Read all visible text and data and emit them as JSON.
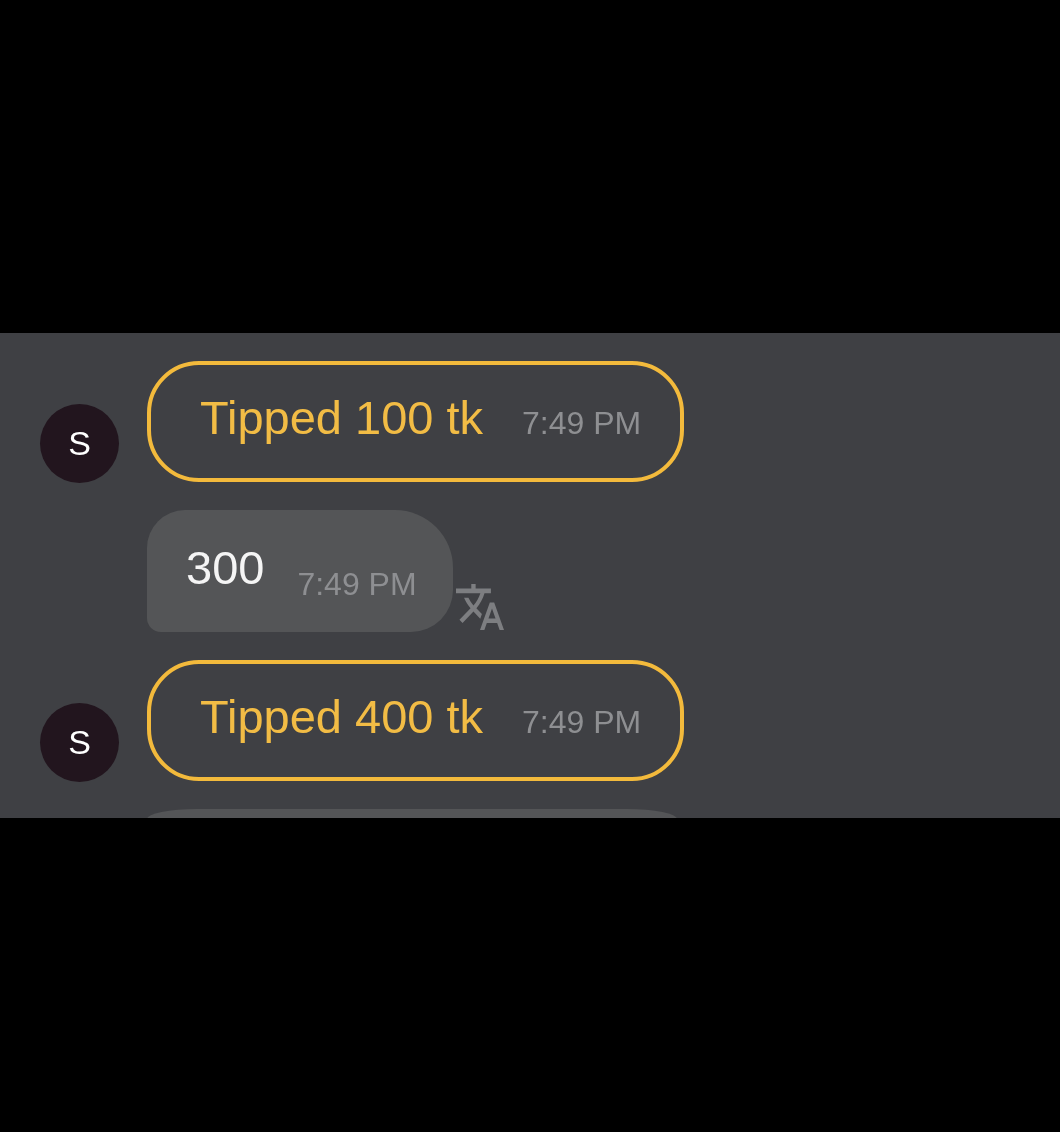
{
  "messages": [
    {
      "kind": "tip",
      "avatar": "S",
      "text": "Tipped 100 tk",
      "time": "7:49 PM"
    },
    {
      "kind": "text",
      "text": "300",
      "time": "7:49 PM",
      "translate": true
    },
    {
      "kind": "tip",
      "avatar": "S",
      "text": "Tipped 400 tk",
      "time": "7:49 PM"
    },
    {
      "kind": "partial"
    }
  ]
}
